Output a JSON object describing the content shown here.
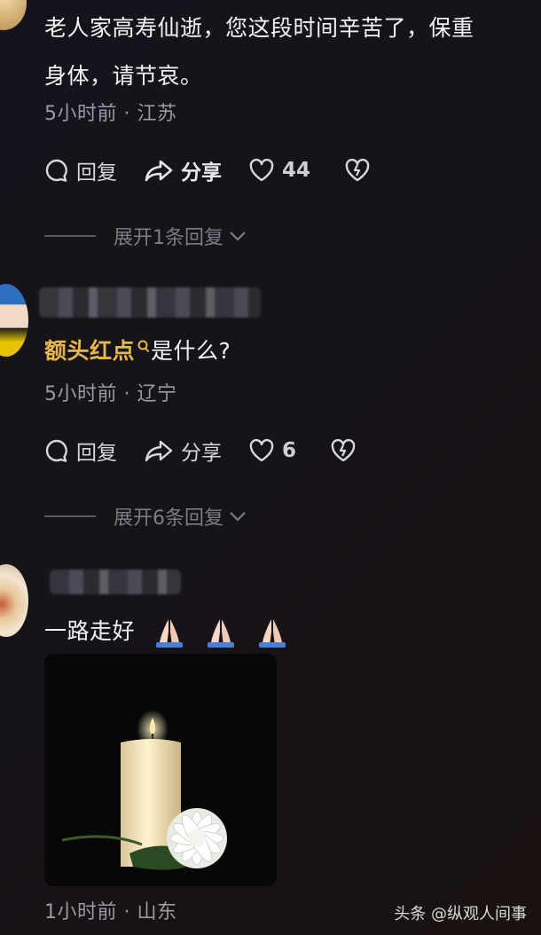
{
  "comments": [
    {
      "text_line1": "老人家高寿仙逝，您这段时间辛苦了，保重",
      "text_line2": "身体，请节哀。",
      "meta": "5小时前 · 江苏",
      "actions": {
        "reply": "回复",
        "share": "分享",
        "likes": "44"
      },
      "expand": "展开1条回复"
    },
    {
      "keyword": "额头红点",
      "text_suffix": "是什么?",
      "meta": "5小时前 · 辽宁",
      "actions": {
        "reply": "回复",
        "share": "分享",
        "likes": "6"
      },
      "expand": "展开6条回复"
    },
    {
      "text": "一路走好",
      "meta": "1小时前 · 山东"
    }
  ],
  "watermark": "头条 @纵观人间事",
  "colors": {
    "background": "#16141a",
    "keyword": "#e6b84a",
    "meta": "#9a9aa2"
  },
  "icons": [
    "reply-icon",
    "share-icon",
    "heart-icon",
    "broken-heart-icon",
    "chevron-down-icon",
    "search-icon",
    "praying-hands-emoji"
  ]
}
